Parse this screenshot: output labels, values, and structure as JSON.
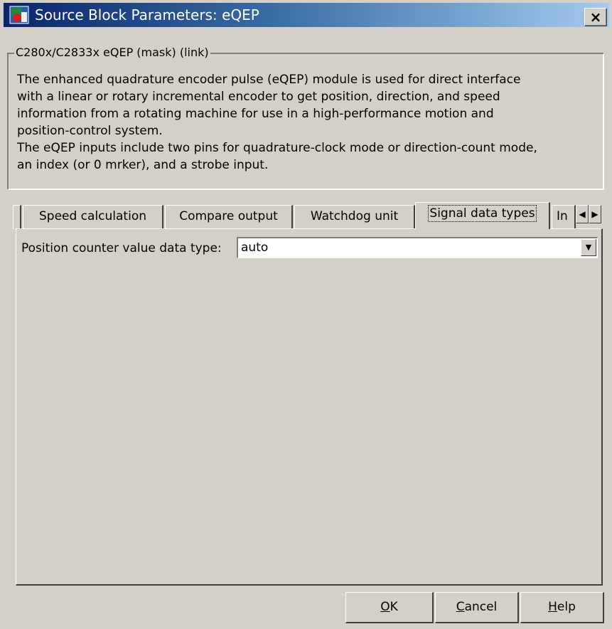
{
  "window": {
    "title": "Source Block Parameters: eQEP",
    "close_label": "×"
  },
  "group": {
    "legend": "C280x/C2833x eQEP (mask) (link)",
    "description": [
      "The enhanced quadrature encoder pulse (eQEP) module is used for direct interface",
      "with a linear or rotary incremental encoder to get position, direction, and speed",
      "information from a rotating machine for use in a high-performance motion and",
      "position-control system.",
      "The eQEP inputs include two pins for quadrature-clock mode or direction-count mode,",
      "an index (or 0 mrker), and a strobe input."
    ]
  },
  "tabs": [
    {
      "label": "Speed calculation",
      "active": false
    },
    {
      "label": "Compare output",
      "active": false
    },
    {
      "label": "Watchdog unit",
      "active": false
    },
    {
      "label": "Signal data types",
      "active": true
    },
    {
      "label": "In",
      "active": false
    }
  ],
  "tab_scroll": {
    "left_icon": "◀",
    "right_icon": "▶"
  },
  "panel": {
    "field_label": "Position counter value data type:",
    "field_value": "auto",
    "dropdown_icon": "▼"
  },
  "buttons": {
    "ok": {
      "mnemonic": "O",
      "rest": "K"
    },
    "cancel": {
      "mnemonic": "C",
      "rest": "ancel"
    },
    "help": {
      "mnemonic": "H",
      "rest": "elp"
    }
  },
  "colors": {
    "title_gradient_start": "#0a246a",
    "title_gradient_end": "#a6caf0",
    "face": "#d4d0c8"
  }
}
